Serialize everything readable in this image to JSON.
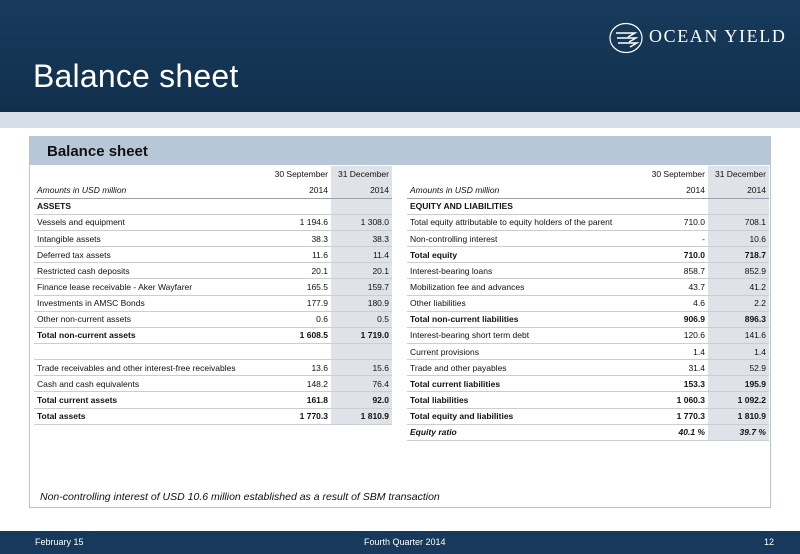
{
  "header": {
    "title": "Balance sheet",
    "logo_text": "OCEAN YIELD"
  },
  "panel": {
    "title": "Balance sheet",
    "footnote": "Non-controlling interest of USD 10.6 million established as a result of SBM transaction"
  },
  "left_table": {
    "period_headers": [
      "30 September",
      "31 December"
    ],
    "units_label": "Amounts in USD million",
    "years": [
      "2014",
      "2014"
    ],
    "section_label": "ASSETS",
    "rows": [
      {
        "label": "Vessels and equipment",
        "v1": "1 194.6",
        "v2": "1 308.0",
        "bold": false,
        "blank": false
      },
      {
        "label": "Intangible assets",
        "v1": "38.3",
        "v2": "38.3",
        "bold": false,
        "blank": false
      },
      {
        "label": "Deferred tax assets",
        "v1": "11.6",
        "v2": "11.4",
        "bold": false,
        "blank": false
      },
      {
        "label": "Restricted cash deposits",
        "v1": "20.1",
        "v2": "20.1",
        "bold": false,
        "blank": false
      },
      {
        "label": "Finance lease receivable - Aker Wayfarer",
        "v1": "165.5",
        "v2": "159.7",
        "bold": false,
        "blank": false
      },
      {
        "label": "Investments in AMSC Bonds",
        "v1": "177.9",
        "v2": "180.9",
        "bold": false,
        "blank": false
      },
      {
        "label": "Other non-current assets",
        "v1": "0.6",
        "v2": "0.5",
        "bold": false,
        "blank": false
      },
      {
        "label": "Total non-current assets",
        "v1": "1 608.5",
        "v2": "1 719.0",
        "bold": true,
        "blank": false
      },
      {
        "label": "",
        "v1": "",
        "v2": "",
        "bold": false,
        "blank": true
      },
      {
        "label": "Trade receivables and  other interest-free receivables",
        "v1": "13.6",
        "v2": "15.6",
        "bold": false,
        "blank": false
      },
      {
        "label": "Cash and cash equivalents",
        "v1": "148.2",
        "v2": "76.4",
        "bold": false,
        "blank": false
      },
      {
        "label": "Total current assets",
        "v1": "161.8",
        "v2": "92.0",
        "bold": true,
        "blank": false
      },
      {
        "label": "Total assets",
        "v1": "1 770.3",
        "v2": "1 810.9",
        "bold": true,
        "blank": false
      }
    ]
  },
  "right_table": {
    "period_headers": [
      "30 September",
      "31 December"
    ],
    "units_label": "Amounts in USD million",
    "years": [
      "2014",
      "2014"
    ],
    "section_label": "EQUITY AND LIABILITIES",
    "rows": [
      {
        "label": "Total equity attributable to equity holders of the parent",
        "v1": "710.0",
        "v2": "708.1",
        "bold": false,
        "italic": false
      },
      {
        "label": "Non-controlling interest",
        "v1": "-",
        "v2": "10.6",
        "bold": false,
        "italic": false
      },
      {
        "label": "Total equity",
        "v1": "710.0",
        "v2": "718.7",
        "bold": true,
        "italic": false
      },
      {
        "label": "Interest-bearing loans",
        "v1": "858.7",
        "v2": "852.9",
        "bold": false,
        "italic": false
      },
      {
        "label": "Mobilization fee and advances",
        "v1": "43.7",
        "v2": "41.2",
        "bold": false,
        "italic": false
      },
      {
        "label": "Other liabilities",
        "v1": "4.6",
        "v2": "2.2",
        "bold": false,
        "italic": false
      },
      {
        "label": "Total non-current liabilities",
        "v1": "906.9",
        "v2": "896.3",
        "bold": true,
        "italic": false
      },
      {
        "label": "Interest-bearing short term debt",
        "v1": "120.6",
        "v2": "141.6",
        "bold": false,
        "italic": false
      },
      {
        "label": "Current provisions",
        "v1": "1.4",
        "v2": "1.4",
        "bold": false,
        "italic": false
      },
      {
        "label": "Trade and other payables",
        "v1": "31.4",
        "v2": "52.9",
        "bold": false,
        "italic": false
      },
      {
        "label": "Total current liabilities",
        "v1": "153.3",
        "v2": "195.9",
        "bold": true,
        "italic": false
      },
      {
        "label": "Total liabilities",
        "v1": "1 060.3",
        "v2": "1 092.2",
        "bold": true,
        "italic": false
      },
      {
        "label": "Total equity and liabilities",
        "v1": "1 770.3",
        "v2": "1 810.9",
        "bold": true,
        "italic": false
      },
      {
        "label": "Equity ratio",
        "v1": "40.1 %",
        "v2": "39.7 %",
        "bold": true,
        "italic": true
      }
    ]
  },
  "footer": {
    "date": "February 15",
    "center": "Fourth Quarter 2014",
    "page": "12"
  },
  "colors": {
    "header_bg": "#183b5c",
    "panel_header_bg": "#b7c7d8",
    "shaded_column": "#dfe3e7"
  }
}
